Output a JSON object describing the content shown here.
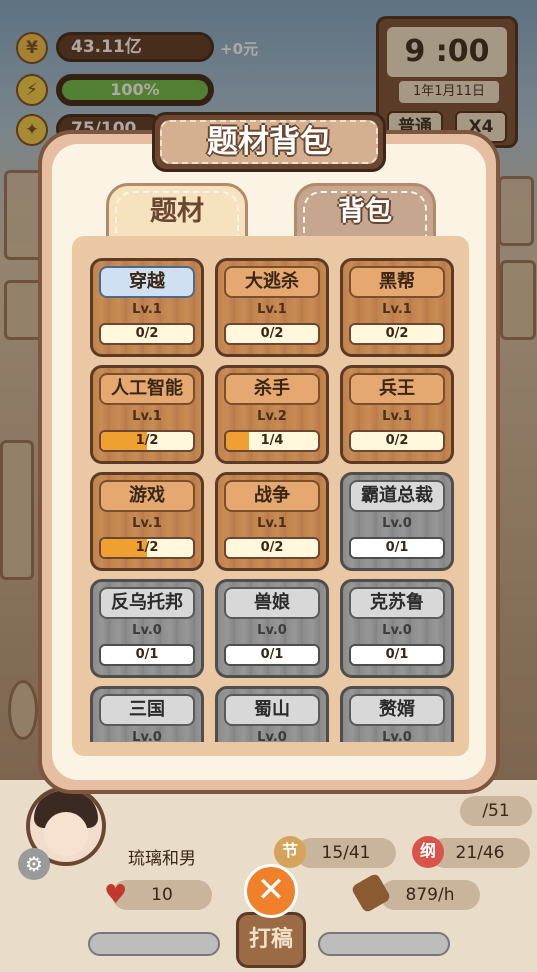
{
  "hud": {
    "money": "43.11亿",
    "money_delta": "+0元",
    "energy": "100%",
    "energy_fill": 1.0,
    "idea": "75/100"
  },
  "clock": {
    "time": "9 :00",
    "date": "1年1月11日",
    "mode": "普通",
    "speed": "X4"
  },
  "panel": {
    "title": "题材背包",
    "tabs": [
      {
        "label": "题材",
        "active": true
      },
      {
        "label": "背包",
        "active": false
      }
    ]
  },
  "cards": [
    {
      "name": "穿越",
      "lv": "Lv.1",
      "progress": "0/2",
      "fill": 0,
      "style": "wood",
      "selected": true
    },
    {
      "name": "大逃杀",
      "lv": "Lv.1",
      "progress": "0/2",
      "fill": 0,
      "style": "wood"
    },
    {
      "name": "黑帮",
      "lv": "Lv.1",
      "progress": "0/2",
      "fill": 0,
      "style": "wood"
    },
    {
      "name": "人工智能",
      "lv": "Lv.1",
      "progress": "1/2",
      "fill": 0.5,
      "style": "wood"
    },
    {
      "name": "杀手",
      "lv": "Lv.2",
      "progress": "1/4",
      "fill": 0.25,
      "style": "wood"
    },
    {
      "name": "兵王",
      "lv": "Lv.1",
      "progress": "0/2",
      "fill": 0,
      "style": "wood"
    },
    {
      "name": "游戏",
      "lv": "Lv.1",
      "progress": "1/2",
      "fill": 0.5,
      "style": "wood"
    },
    {
      "name": "战争",
      "lv": "Lv.1",
      "progress": "0/2",
      "fill": 0,
      "style": "wood"
    },
    {
      "name": "霸道总裁",
      "lv": "Lv.0",
      "progress": "0/1",
      "fill": 0,
      "style": "grey"
    },
    {
      "name": "反乌托邦",
      "lv": "Lv.0",
      "progress": "0/1",
      "fill": 0,
      "style": "grey"
    },
    {
      "name": "兽娘",
      "lv": "Lv.0",
      "progress": "0/1",
      "fill": 0,
      "style": "grey"
    },
    {
      "name": "克苏鲁",
      "lv": "Lv.0",
      "progress": "0/1",
      "fill": 0,
      "style": "grey"
    },
    {
      "name": "三国",
      "lv": "Lv.0",
      "progress": "",
      "fill": 0,
      "style": "grey"
    },
    {
      "name": "蜀山",
      "lv": "Lv.0",
      "progress": "",
      "fill": 0,
      "style": "grey"
    },
    {
      "name": "赘婿",
      "lv": "Lv.0",
      "progress": "",
      "fill": 0,
      "style": "grey"
    }
  ],
  "bottom": {
    "author_name": "琉璃和男",
    "jie_label": "节",
    "jie_value": "15/41",
    "gang_label": "纲",
    "gang_value": "21/46",
    "right_value": "/51",
    "hearts": "10",
    "rate": "879/h",
    "close_icon": "✕",
    "submit_label": "打稿"
  },
  "colors": {
    "wood": "#c0824c",
    "grey": "#8c8c8c",
    "progress_fill": "#f0a030",
    "energy": "#6cbf4a"
  }
}
